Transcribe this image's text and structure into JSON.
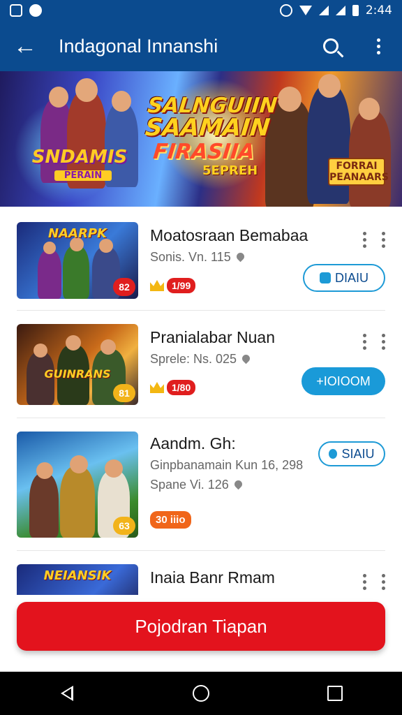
{
  "status_bar": {
    "time": "2:44"
  },
  "app_bar": {
    "title": "Indagonal Innanshi"
  },
  "banner": {
    "title_lines": [
      "SALNGUIIN",
      "SAAMAIN",
      "FIRASIIA"
    ],
    "subtitle": "5EPREH",
    "left_logo": "SNDAMIS",
    "left_logo_sub": "PERAIN",
    "right_logo": "FORRAI PEANAARS"
  },
  "items": [
    {
      "title": "Moatosraan Bemabaa",
      "meta": "Sonis. Vn. 115",
      "rating": "1/99",
      "badge": "82",
      "thumb_title": "NAARPK",
      "action": "DIAIU",
      "action_style": "outline"
    },
    {
      "title": "Pranialabar Nuan",
      "meta": "Sprele: Ns. 025",
      "rating": "1/80",
      "badge": "81",
      "thumb_title": "GUINRANS",
      "action": "+IOIOOM",
      "action_style": "filled"
    },
    {
      "title": "Aandm. Gh:",
      "meta_line1": "Ginpbanamain Kun 16, 298",
      "meta": "Spane Vi. 126",
      "rating": "30 iiio",
      "badge": "63",
      "action": "SIAIU",
      "action_style": "outline"
    },
    {
      "title": "Inaia Banr Rmam",
      "thumb_title": "NEIANSIK"
    }
  ],
  "primary_button": {
    "label": "Pojodran Tiapan"
  },
  "colors": {
    "primary": "#0b4b8f",
    "accent": "#e3131d",
    "action": "#1a9ad8"
  }
}
